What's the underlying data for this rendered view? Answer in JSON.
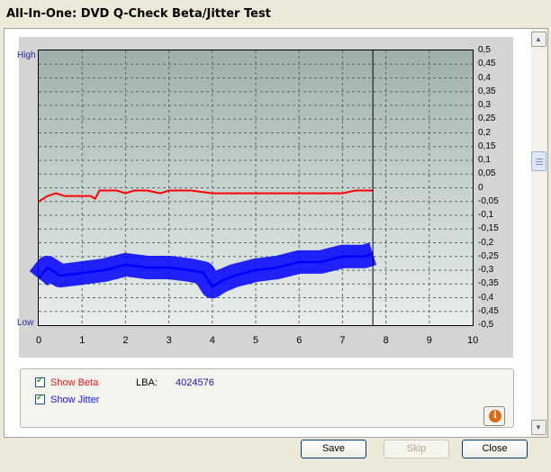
{
  "window": {
    "title": "All-In-One: DVD Q-Check Beta/Jitter Test"
  },
  "plot": {
    "left_label_high": "High",
    "left_label_low": "Low",
    "right_ticks": [
      "0,5",
      "0,45",
      "0,4",
      "0,35",
      "0,3",
      "0,25",
      "0,2",
      "0,15",
      "0,1",
      "0,05",
      "0",
      "-0,05",
      "-0,1",
      "-0,15",
      "-0,2",
      "-0,25",
      "-0,3",
      "-0,35",
      "-0,4",
      "-0,45",
      "-0,5"
    ],
    "x_ticks": [
      "0",
      "1",
      "2",
      "3",
      "4",
      "5",
      "6",
      "7",
      "8",
      "9",
      "10"
    ],
    "colors": {
      "beta": "#ff0000",
      "jitter": "#0000ff"
    }
  },
  "chart_data": {
    "type": "line",
    "x_range": [
      0,
      10
    ],
    "y_range": [
      -0.5,
      0.5
    ],
    "cursor_x": 7.7,
    "series": [
      {
        "name": "Beta",
        "x": [
          0,
          0.2,
          0.4,
          0.6,
          0.8,
          1.0,
          1.2,
          1.3,
          1.4,
          1.6,
          1.8,
          2.0,
          2.2,
          2.5,
          2.8,
          3.0,
          3.5,
          4.0,
          4.5,
          5.0,
          5.5,
          6.0,
          6.5,
          7.0,
          7.3,
          7.5,
          7.7
        ],
        "values": [
          -0.05,
          -0.03,
          -0.02,
          -0.03,
          -0.03,
          -0.03,
          -0.03,
          -0.04,
          -0.01,
          -0.01,
          -0.01,
          -0.02,
          -0.01,
          -0.01,
          -0.02,
          -0.01,
          -0.01,
          -0.02,
          -0.02,
          -0.02,
          -0.02,
          -0.02,
          -0.02,
          -0.02,
          -0.01,
          -0.01,
          -0.01
        ]
      },
      {
        "name": "Jitter",
        "x": [
          0,
          0.2,
          0.5,
          1.0,
          1.5,
          2.0,
          2.5,
          3.0,
          3.5,
          3.8,
          4.0,
          4.2,
          4.5,
          5.0,
          5.5,
          6.0,
          6.5,
          7.0,
          7.5,
          7.7
        ],
        "values": [
          -0.33,
          -0.29,
          -0.32,
          -0.31,
          -0.3,
          -0.28,
          -0.29,
          -0.29,
          -0.3,
          -0.31,
          -0.36,
          -0.34,
          -0.32,
          -0.3,
          -0.29,
          -0.27,
          -0.27,
          -0.25,
          -0.25,
          -0.24
        ]
      }
    ]
  },
  "options": {
    "show_beta": "Show Beta",
    "show_jitter": "Show Jitter"
  },
  "lba": {
    "label": "LBA:",
    "value": "4024576"
  },
  "buttons": {
    "save": "Save",
    "skip": "Skip",
    "close": "Close"
  },
  "icons": {
    "info": "info-icon",
    "scroll_up": "scroll-up-arrow-icon",
    "scroll_down": "scroll-down-arrow-icon"
  }
}
